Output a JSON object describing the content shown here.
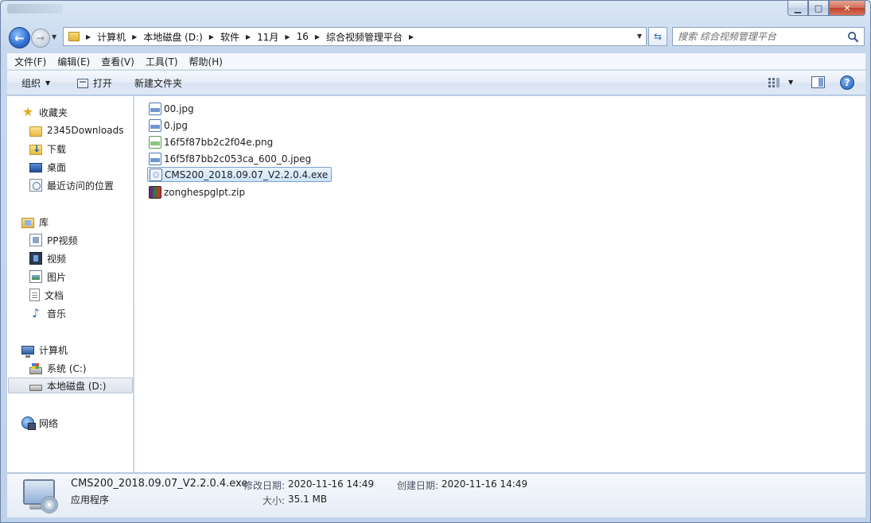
{
  "window": {
    "title": ""
  },
  "address": {
    "breadcrumbs": [
      "计算机",
      "本地磁盘 (D:)",
      "软件",
      "11月",
      "16",
      "综合视频管理平台"
    ]
  },
  "search": {
    "placeholder": "搜索 综合视频管理平台"
  },
  "menu": [
    "文件(F)",
    "编辑(E)",
    "查看(V)",
    "工具(T)",
    "帮助(H)"
  ],
  "toolbar": {
    "organize": "组织",
    "open": "打开",
    "new_folder": "新建文件夹"
  },
  "nav": {
    "favorites": {
      "label": "收藏夹",
      "items": [
        "2345Downloads",
        "下载",
        "桌面",
        "最近访问的位置"
      ]
    },
    "libraries": {
      "label": "库",
      "items": [
        "PP视频",
        "视频",
        "图片",
        "文档",
        "音乐"
      ]
    },
    "computer": {
      "label": "计算机",
      "items": [
        "系统 (C:)",
        "本地磁盘 (D:)"
      ]
    },
    "network": {
      "label": "网络"
    }
  },
  "files": [
    {
      "name": "00.jpg",
      "type": "jpg"
    },
    {
      "name": "0.jpg",
      "type": "jpg"
    },
    {
      "name": "16f5f87bb2c2f04e.png",
      "type": "png"
    },
    {
      "name": "16f5f87bb2c053ca_600_0.jpeg",
      "type": "jpg"
    },
    {
      "name": "CMS200_2018.09.07_V2.2.0.4.exe",
      "type": "exe",
      "selected": true
    },
    {
      "name": "zonghespglpt.zip",
      "type": "zip"
    }
  ],
  "details": {
    "name": "CMS200_2018.09.07_V2.2.0.4.exe",
    "type": "应用程序",
    "modified_label": "修改日期:",
    "modified": "2020-11-16 14:49",
    "created_label": "创建日期:",
    "created": "2020-11-16 14:49",
    "size_label": "大小:",
    "size": "35.1 MB"
  }
}
